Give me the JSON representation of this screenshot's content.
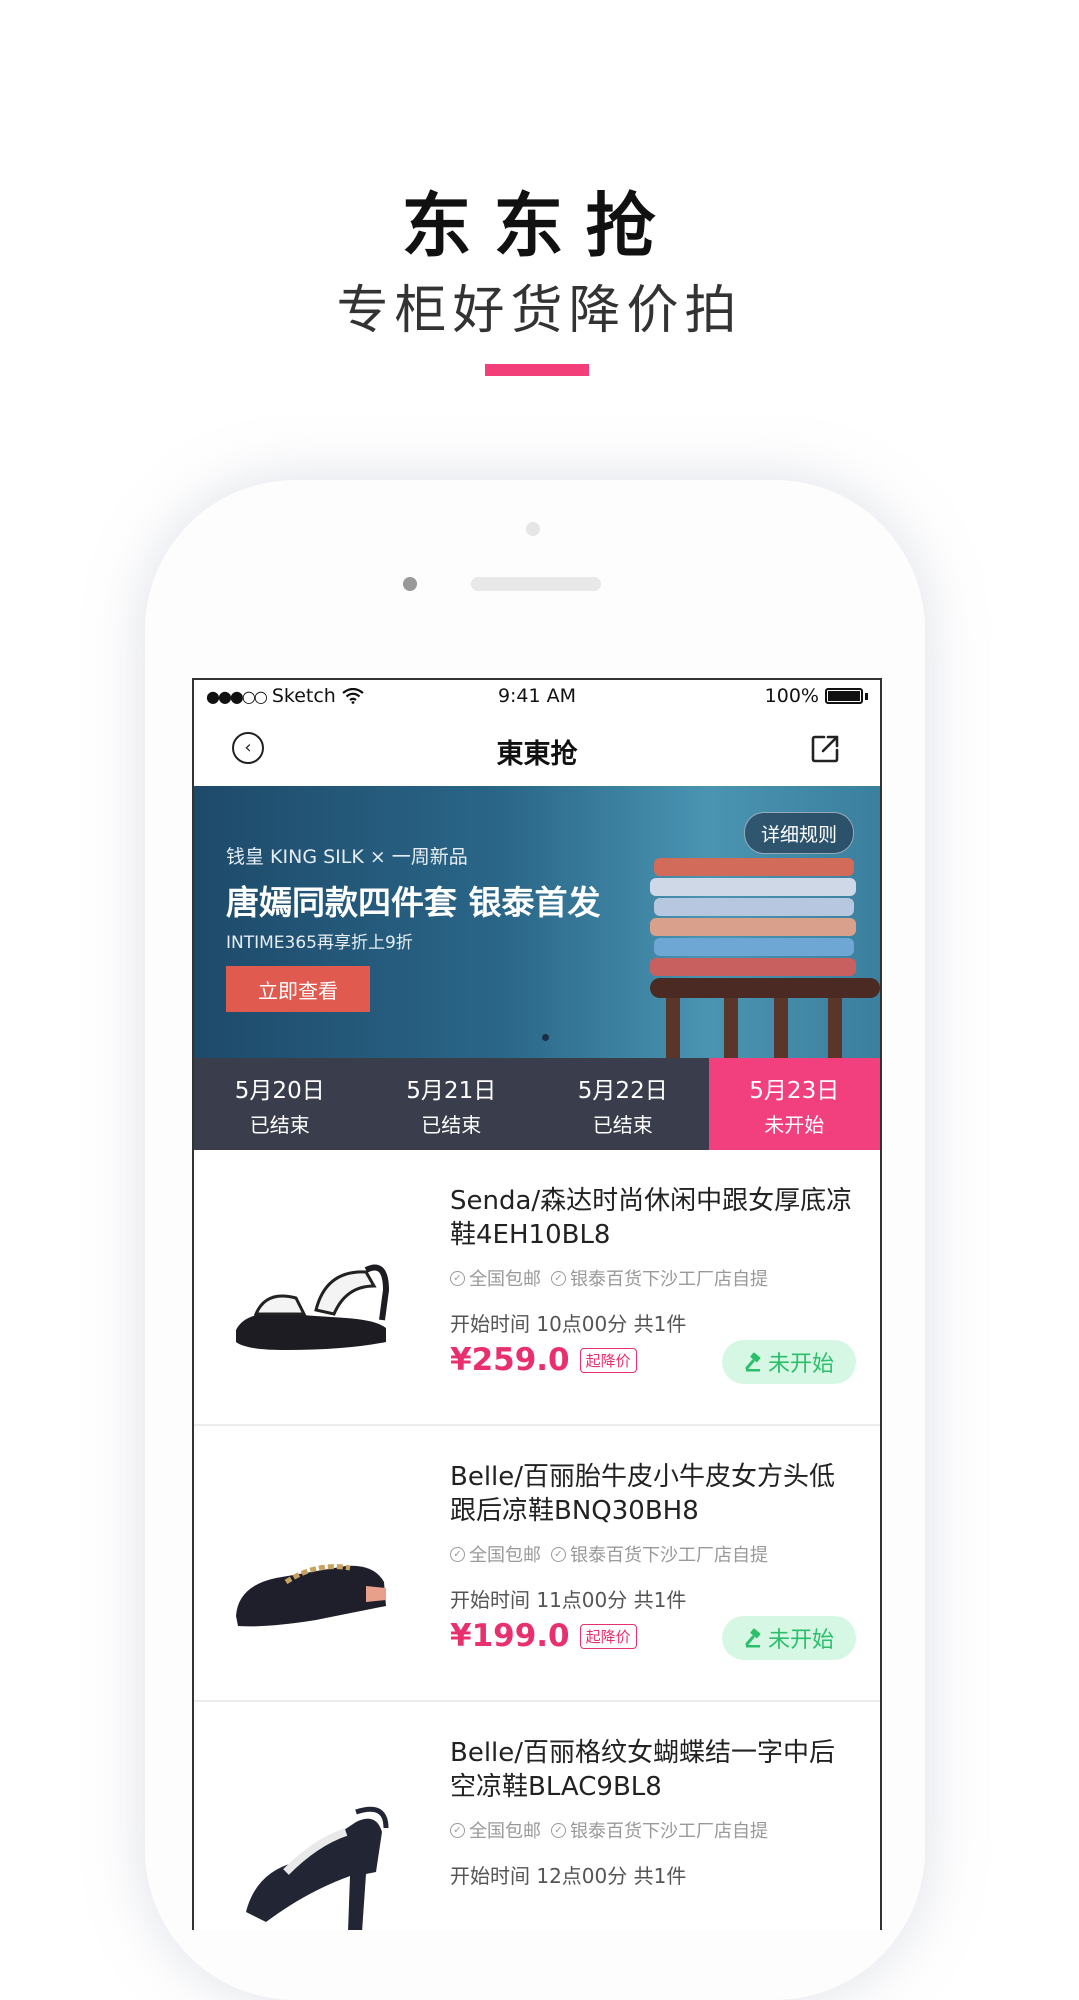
{
  "hero": {
    "title": "东东抢",
    "subtitle": "专柜好货降价拍",
    "accent_color": "#f23f7a"
  },
  "statusbar": {
    "carrier": "Sketch",
    "signal": "●●●○○",
    "time": "9:41 AM",
    "battery": "100%"
  },
  "navbar": {
    "title": "東東抢",
    "back_icon": "back-circle-icon",
    "share_icon": "share-icon"
  },
  "banner": {
    "brand": "钱皇 KING SILK × 一周新品",
    "headline": "唐嫣同款四件套 银泰首发",
    "sub": "INTIME365再享折上9折",
    "cta": "立即查看",
    "rules": "详细规则"
  },
  "date_tabs": [
    {
      "date": "5月20日",
      "status": "已结束",
      "active": false
    },
    {
      "date": "5月21日",
      "status": "已结束",
      "active": false
    },
    {
      "date": "5月22日",
      "status": "已结束",
      "active": false
    },
    {
      "date": "5月23日",
      "status": "未开始",
      "active": true
    }
  ],
  "products": [
    {
      "title": "Senda/森达时尚休闲中跟女厚底凉鞋4EH10BL8",
      "tags": [
        "全国包邮",
        "银泰百货下沙工厂店自提"
      ],
      "time": "开始时间 10点00分 共1件",
      "price": "¥259.0",
      "price_tag": "起降价",
      "status": "未开始"
    },
    {
      "title": "Belle/百丽胎牛皮小牛皮女方头低跟后凉鞋BNQ30BH8",
      "tags": [
        "全国包邮",
        "银泰百货下沙工厂店自提"
      ],
      "time": "开始时间 11点00分 共1件",
      "price": "¥199.0",
      "price_tag": "起降价",
      "status": "未开始"
    },
    {
      "title": "Belle/百丽格纹女蝴蝶结一字中后空凉鞋BLAC9BL8",
      "tags": [
        "全国包邮",
        "银泰百货下沙工厂店自提"
      ],
      "time": "开始时间 12点00分 共1件",
      "price": "",
      "price_tag": "",
      "status": ""
    }
  ],
  "colors": {
    "active_tab": "#f2407e",
    "tab_bg": "#3a3e4c",
    "price": "#e8306f",
    "status_bg": "#d6f7e3",
    "status_text": "#2bbf6b"
  }
}
